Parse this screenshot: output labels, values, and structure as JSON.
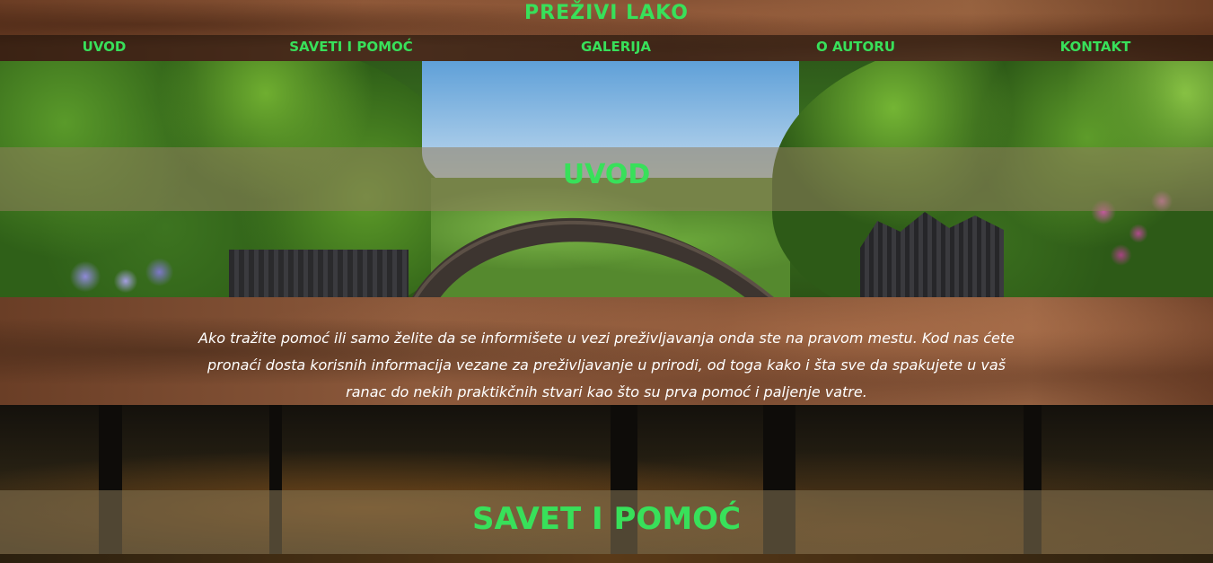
{
  "header": {
    "site_title": "PREŽIVI LAKO",
    "nav": [
      {
        "label": "UVOD"
      },
      {
        "label": "SAVETI I POMOĆ"
      },
      {
        "label": "GALERIJA"
      },
      {
        "label": "O AUTORU"
      },
      {
        "label": "KONTAKT"
      }
    ]
  },
  "sections": {
    "uvod": {
      "heading": "UVOD",
      "text": "Ako tražite pomoć ili samo želite da se informišete u vezi preživljavanja onda ste na pravom mestu. Kod nas ćete pronaći dosta korisnih informacija vezane za preživljavanje u prirodi, od toga kako i šta sve da spakujete u vaš ranac do nekih praktikčnih stvari kao što su prva pomoć i paljenje vatre."
    },
    "savet": {
      "heading": "SAVET I POMOĆ"
    }
  },
  "colors": {
    "accent_green": "#38e05a",
    "brown_texture": "#7e4e33",
    "text_white": "#ffffff"
  }
}
